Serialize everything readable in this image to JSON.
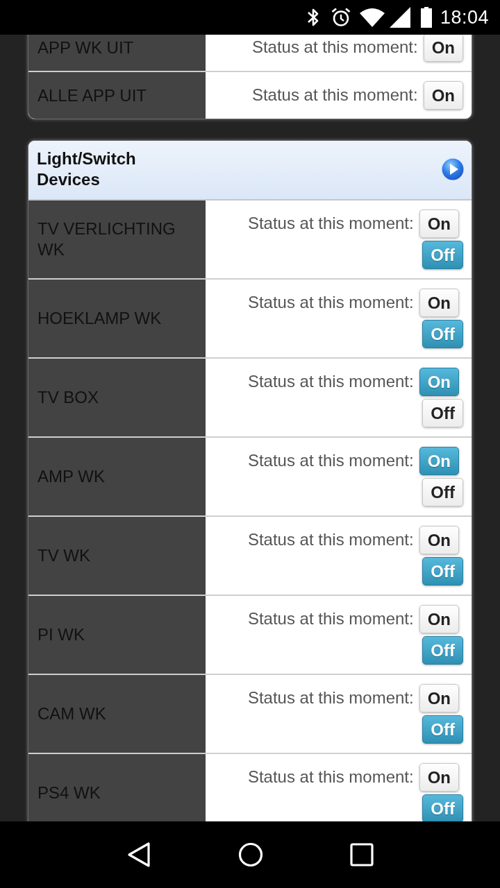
{
  "status_bar": {
    "time": "18:04"
  },
  "sections": [
    {
      "rows": [
        {
          "name": "APP WK UIT",
          "status_label": "Status at this moment:",
          "buttons": [
            {
              "label": "On",
              "selected": false
            }
          ]
        },
        {
          "name": "ALLE APP UIT",
          "status_label": "Status at this moment:",
          "buttons": [
            {
              "label": "On",
              "selected": false
            }
          ]
        }
      ]
    },
    {
      "title": "Light/Switch Devices",
      "rows": [
        {
          "name": "TV VERLICHTING WK",
          "status_label": "Status at this moment:",
          "buttons": [
            {
              "label": "On",
              "selected": false
            },
            {
              "label": "Off",
              "selected": true
            }
          ]
        },
        {
          "name": "HOEKLAMP WK",
          "status_label": "Status at this moment:",
          "buttons": [
            {
              "label": "On",
              "selected": false
            },
            {
              "label": "Off",
              "selected": true
            }
          ]
        },
        {
          "name": "TV BOX",
          "status_label": "Status at this moment:",
          "buttons": [
            {
              "label": "On",
              "selected": true
            },
            {
              "label": "Off",
              "selected": false
            }
          ]
        },
        {
          "name": "AMP WK",
          "status_label": "Status at this moment:",
          "buttons": [
            {
              "label": "On",
              "selected": true
            },
            {
              "label": "Off",
              "selected": false
            }
          ]
        },
        {
          "name": "TV WK",
          "status_label": "Status at this moment:",
          "buttons": [
            {
              "label": "On",
              "selected": false
            },
            {
              "label": "Off",
              "selected": true
            }
          ]
        },
        {
          "name": "PI WK",
          "status_label": "Status at this moment:",
          "buttons": [
            {
              "label": "On",
              "selected": false
            },
            {
              "label": "Off",
              "selected": true
            }
          ]
        },
        {
          "name": "CAM WK",
          "status_label": "Status at this moment:",
          "buttons": [
            {
              "label": "On",
              "selected": false
            },
            {
              "label": "Off",
              "selected": true
            }
          ]
        },
        {
          "name": "PS4 WK",
          "status_label": "Status at this moment:",
          "buttons": [
            {
              "label": "On",
              "selected": false
            },
            {
              "label": "Off",
              "selected": true
            }
          ]
        }
      ]
    }
  ]
}
